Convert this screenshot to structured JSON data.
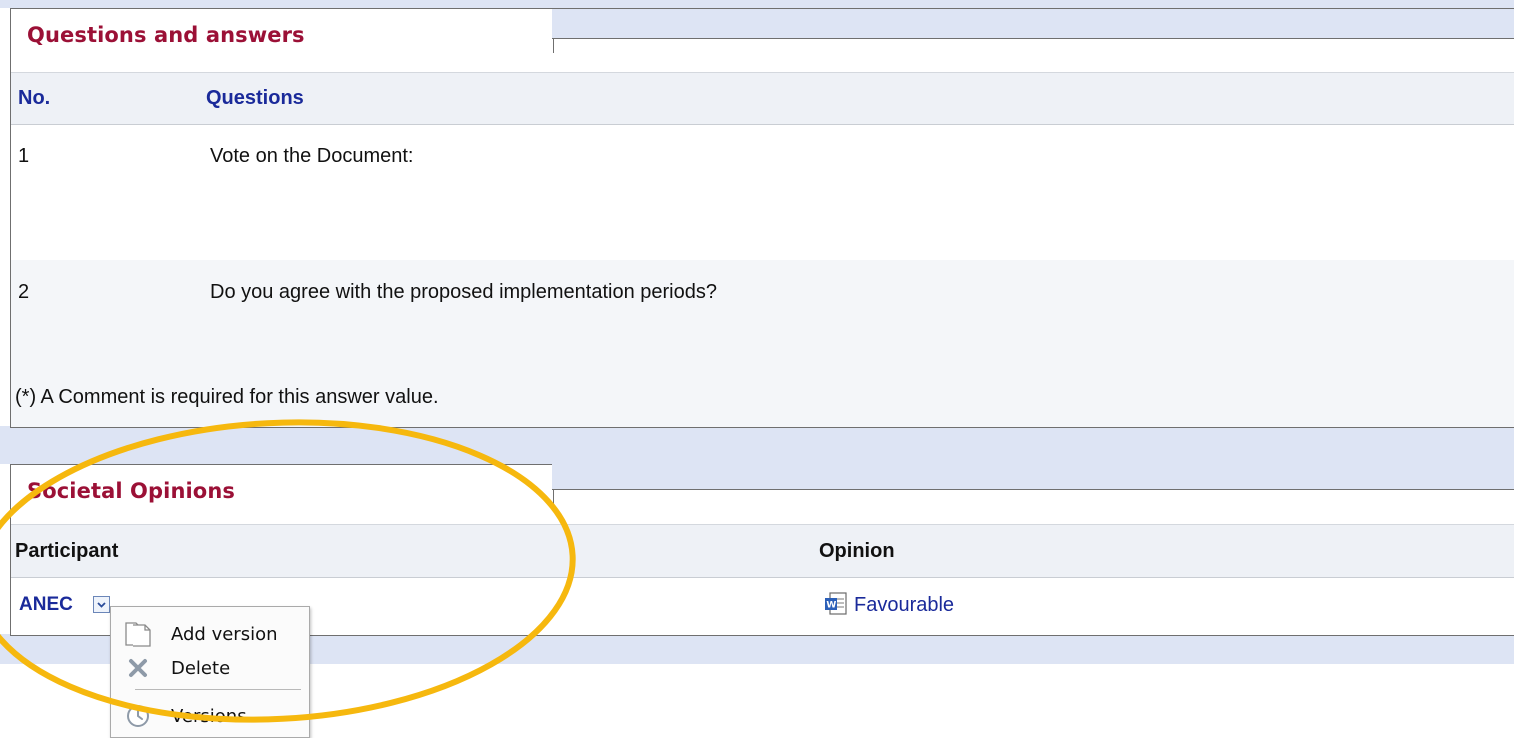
{
  "qa_panel": {
    "title": "Questions and answers",
    "columns": {
      "no": "No.",
      "questions": "Questions"
    },
    "rows": [
      {
        "no": "1",
        "question": "Vote on the Document:"
      },
      {
        "no": "2",
        "question": "Do you agree with the proposed implementation periods?"
      }
    ],
    "footnote": "(*) A Comment is required for this answer value."
  },
  "opinions_panel": {
    "title": "Societal Opinions",
    "columns": {
      "participant": "Participant",
      "opinion": "Opinion"
    },
    "rows": [
      {
        "participant": "ANEC",
        "opinion": "Favourable",
        "opinion_icon": "word-document-icon"
      }
    ]
  },
  "context_menu": {
    "items": [
      {
        "label": "Add version",
        "icon": "document-icon"
      },
      {
        "label": "Delete",
        "icon": "x-icon"
      },
      {
        "label": "Versions",
        "icon": "clock-icon"
      }
    ]
  },
  "colors": {
    "panel_title": "#9b1036",
    "column_header_link": "#1a2a9a",
    "link": "#1a2a9a",
    "band": "#dde4f4",
    "highlight_ellipse": "#f6b80e"
  }
}
